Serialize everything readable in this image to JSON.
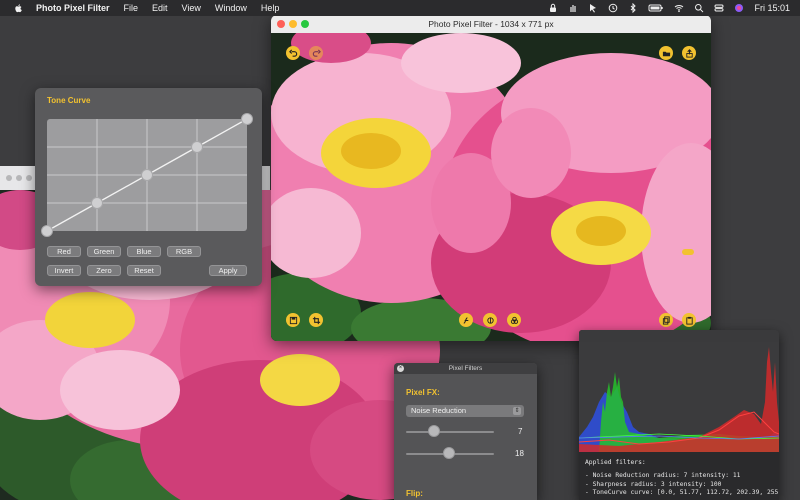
{
  "menubar": {
    "app_name": "Photo Pixel Filter",
    "menus": [
      "File",
      "Edit",
      "View",
      "Window",
      "Help"
    ],
    "clock": "Fri 15:01"
  },
  "photo_window": {
    "title": "Photo Pixel Filter - 1034 x 771 px"
  },
  "tone_curve": {
    "title": "Tone Curve",
    "channel_buttons": [
      "Red",
      "Green",
      "Blue",
      "RGB"
    ],
    "action_buttons": [
      "Invert",
      "Zero",
      "Reset"
    ],
    "apply_label": "Apply"
  },
  "filters_panel": {
    "title": "Pixel Filters",
    "fx_label": "Pixel FX:",
    "selected_fx": "Noise Reduction",
    "slider1_value": "7",
    "slider2_value": "18",
    "flip_label": "Flip:"
  },
  "histogram": {
    "applied_title": "Applied filters:",
    "lines": [
      "- Noise Reduction radius: 7 intensity: 11",
      "- Sharpness radius: 3 intensity: 100",
      "- ToneCurve curve: [0.0, 51.77, 112.72, 202.39, 255"
    ]
  },
  "colors": {
    "accent": "#f2c230",
    "panel": "#5a5a5c",
    "menubar": "#2b2b2d"
  }
}
